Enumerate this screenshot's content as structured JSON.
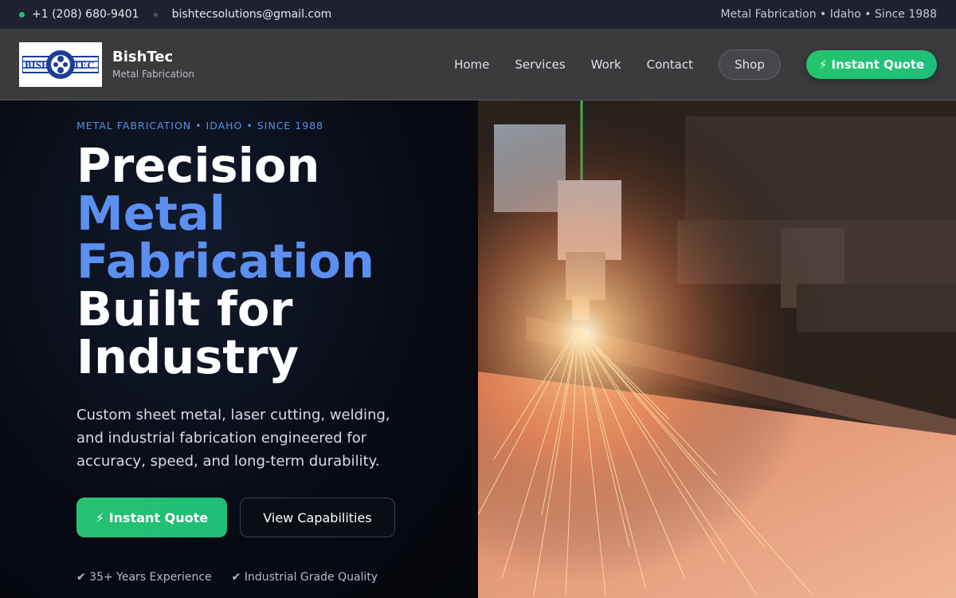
{
  "topbar": {
    "phone": "+1 (208) 680-9401",
    "email": "bishtecsolutions@gmail.com",
    "tagline": "Metal Fabrication • Idaho • Since 1988"
  },
  "header": {
    "brand_name": "BishTec",
    "brand_tagline": "Metal Fabrication",
    "logo_text_left": "BISH",
    "logo_text_right": "TEC",
    "nav": [
      "Home",
      "Services",
      "Work",
      "Contact"
    ],
    "shop_label": "Shop",
    "cta_label": "⚡ Instant Quote"
  },
  "hero": {
    "eyebrow": "METAL FABRICATION • IDAHO • SINCE 1988",
    "headline_1": "Precision",
    "headline_2": "Metal",
    "headline_3": "Fabrication",
    "headline_4": "Built for",
    "headline_5": "Industry",
    "subtext": "Custom sheet metal, laser cutting, welding, and industrial fabrication engineered for accuracy, speed, and long-term durability.",
    "primary_button": "⚡ Instant Quote",
    "secondary_button": "View Capabilities",
    "badge_1": "✔ 35+ Years Experience",
    "badge_2": "✔ Industrial Grade Quality"
  },
  "colors": {
    "accent_green": "#1fbf71",
    "accent_blue": "#5b8ff0",
    "topbar_bg": "#1e2230",
    "header_bg": "#3b3b3e"
  },
  "icons": {
    "phone_status": "green-dot-icon",
    "bolt": "lightning-bolt-icon",
    "check": "check-mark-icon"
  }
}
